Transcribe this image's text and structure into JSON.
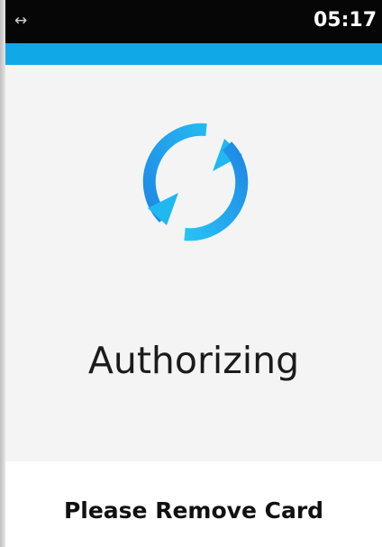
{
  "status_bar": {
    "left_icon": "↔",
    "left_icon_name": "connection-arrows-icon",
    "time": "05:17"
  },
  "colors": {
    "status_bar": "#060606",
    "accent": "#11a8e8",
    "spinner_light": "#20b8f0",
    "spinner_dark": "#1e88e5",
    "content_bg": "#f4f4f4"
  },
  "main": {
    "icon": "refresh-icon",
    "title": "Authorizing"
  },
  "footer": {
    "prompt": "Please Remove Card"
  }
}
